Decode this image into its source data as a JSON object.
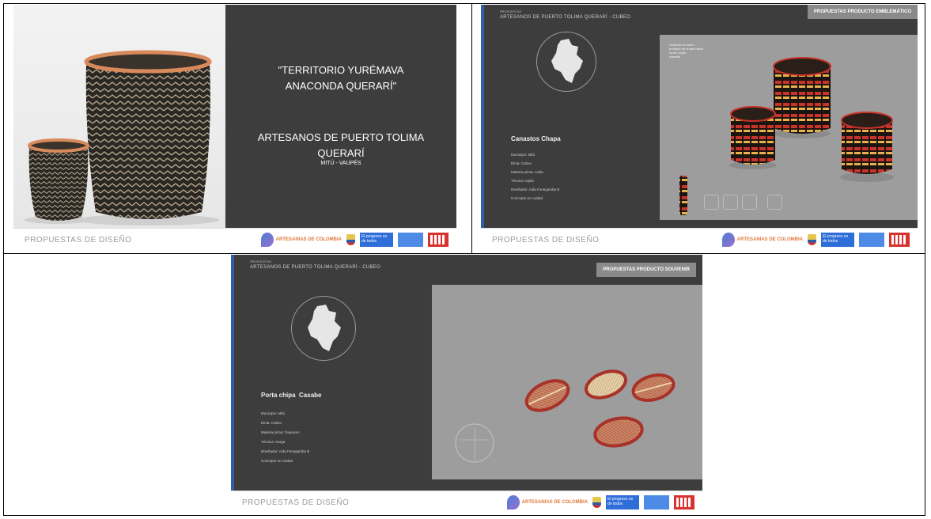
{
  "footer": {
    "label": "PROPUESTAS DE DISEÑO",
    "logo_text_artesanias": "ARTESANIAS DE COLOMBIA",
    "logo_text_gov": "El progreso es de todos"
  },
  "slide1": {
    "title": "\"TERRITORIO YURÉMAVA ANACONDA QUERARÍ\"",
    "subtitle": "ARTESANOS DE PUERTO TOLIMA QUERARÍ",
    "place": "MITÚ - VAUPÉS"
  },
  "slide2": {
    "header_small": "PROPUESTAS",
    "header_main": "ARTESANOS DE PUERTO TOLIMA QUERARÍ - CUBEO",
    "tag": "PROPUESTAS PRODUCTO EMBLEMÁTICO",
    "product_title": "Canastos Chapa",
    "specs": [
      "Municipio: Mitú",
      "Etnia: Cubeo",
      "Materia prima: Caña",
      "Técnica: tejido",
      "Diseñador: Aida Fonegamba B",
      "Concepto en cuidad"
    ],
    "annotation": [
      "Cestería en cuero",
      "bordado de chapa tejido",
      "fondo negro",
      "material"
    ]
  },
  "slide3": {
    "header_small": "PROPUESTAS",
    "header_main": "ARTESANOS DE PUERTO TOLIMA QUERARÍ - CUBEO",
    "tag": "PROPUESTAS PRODUCTO SOUVENIR",
    "product_title": "Porta chipa  Casabe",
    "specs": [
      "Municipio: Mitú",
      "Etnia: Cubeo",
      "Materia prima: Guarumo",
      "Técnica: Sarga",
      "Diseñador: Aida Fonegamba B",
      "Concepto en cuidad"
    ]
  }
}
